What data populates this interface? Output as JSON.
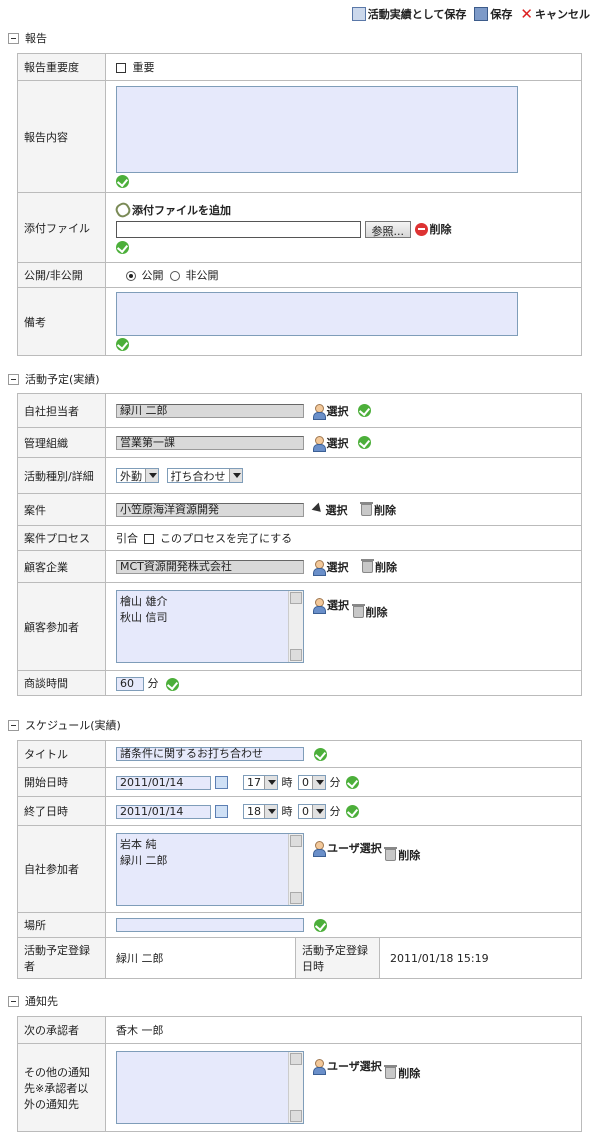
{
  "toolbar": {
    "save_as_result": "活動実績として保存",
    "save": "保存",
    "cancel": "キャンセル"
  },
  "report": {
    "title": "報告",
    "importance_label": "報告重要度",
    "importance_value": "重要",
    "content_label": "報告内容",
    "attachment_label": "添付ファイル",
    "add_attachment": "添付ファイルを追加",
    "browse": "参照...",
    "delete": "削除",
    "visibility_label": "公開/非公開",
    "public": "公開",
    "private": "非公開",
    "remarks_label": "備考"
  },
  "activity": {
    "title": "活動予定(実績)",
    "owner_label": "自社担当者",
    "owner_value": "緑川 二郎",
    "org_label": "管理組織",
    "org_value": "営業第一課",
    "type_label": "活動種別/詳細",
    "type_value": "外勤",
    "detail_value": "打ち合わせ",
    "case_label": "案件",
    "case_value": "小笠原海洋資源開発",
    "process_label": "案件プロセス",
    "process_value": "引合",
    "process_check": "このプロセスを完了にする",
    "customer_label": "顧客企業",
    "customer_value": "MCT資源開発株式会社",
    "participants_label": "顧客参加者",
    "participants": [
      "檜山 雄介",
      "秋山 信司"
    ],
    "meeting_label": "商談時間",
    "meeting_value": "60",
    "meeting_unit": "分",
    "select": "選択",
    "delete": "削除"
  },
  "schedule": {
    "title": "スケジュール(実績)",
    "title_label": "タイトル",
    "title_value": "諸条件に関するお打ち合わせ",
    "start_label": "開始日時",
    "start_date": "2011/01/14",
    "start_hour": "17",
    "start_min": "0",
    "end_label": "終了日時",
    "end_date": "2011/01/14",
    "end_hour": "18",
    "end_min": "0",
    "hour_unit": "時",
    "min_unit": "分",
    "attendees_label": "自社参加者",
    "attendees": [
      "岩本 純",
      "緑川 二郎"
    ],
    "user_select": "ユーザ選択",
    "delete": "削除",
    "place_label": "場所",
    "registrant_label": "活動予定登録者",
    "registrant_value": "緑川 二郎",
    "registered_label": "活動予定登録日時",
    "registered_value": "2011/01/18 15:19"
  },
  "notify": {
    "title": "通知先",
    "approver_label": "次の承認者",
    "approver_value": "香木 一郎",
    "others_label": "その他の通知先※承認者以外の通知先",
    "user_select": "ユーザ選択",
    "delete": "削除"
  }
}
